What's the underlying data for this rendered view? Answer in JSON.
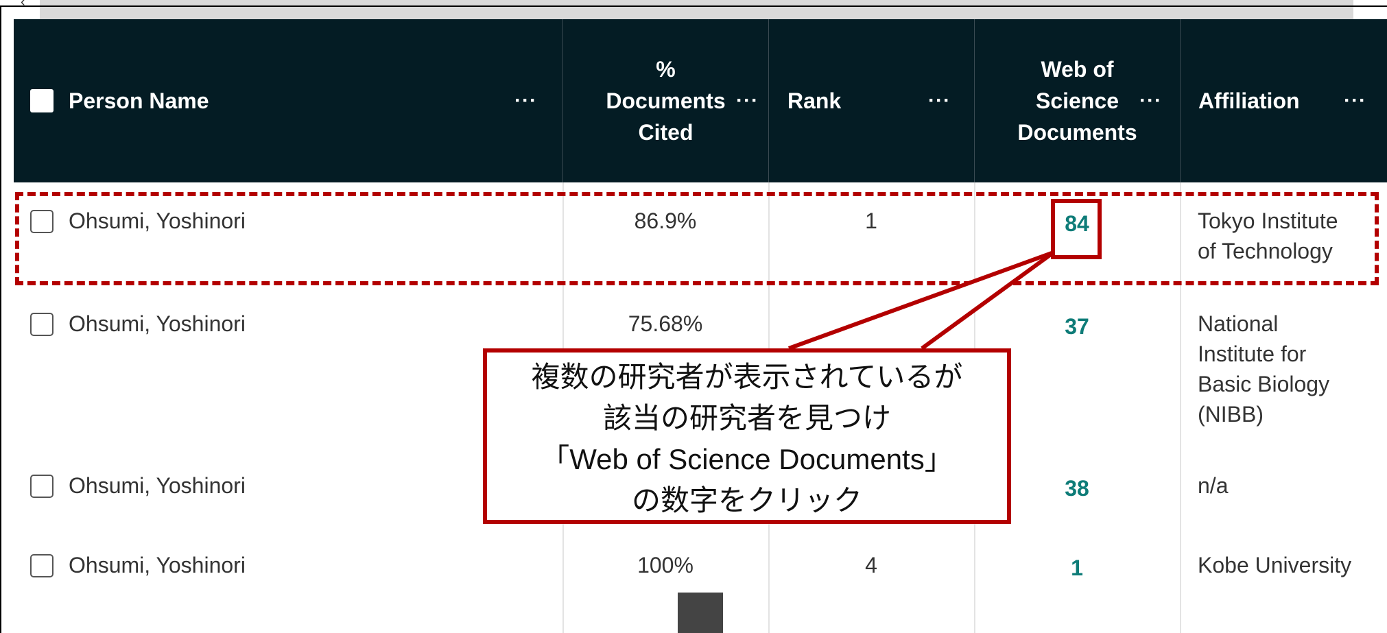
{
  "table": {
    "headers": {
      "person_name": "Person Name",
      "pct_docs_cited_l1": "%",
      "pct_docs_cited_l2": "Documents",
      "pct_docs_cited_l3": "Cited",
      "rank": "Rank",
      "wos_l1": "Web of",
      "wos_l2": "Science",
      "wos_l3": "Documents",
      "affiliation": "Affiliation",
      "menu": "···"
    },
    "rows": [
      {
        "name": "Ohsumi, Yoshinori",
        "pct_cited": "86.9%",
        "rank": "1",
        "wos_docs": "84",
        "affiliation": [
          "Tokyo Institute",
          "of Technology"
        ]
      },
      {
        "name": "Ohsumi, Yoshinori",
        "pct_cited": "75.68%",
        "rank": "",
        "wos_docs": "37",
        "affiliation": [
          "National",
          "Institute for",
          "Basic Biology",
          "(NIBB)"
        ]
      },
      {
        "name": "Ohsumi, Yoshinori",
        "pct_cited": "",
        "rank": "",
        "wos_docs": "38",
        "affiliation": [
          "n/a"
        ]
      },
      {
        "name": "Ohsumi, Yoshinori",
        "pct_cited": "100%",
        "rank": "4",
        "wos_docs": "1",
        "affiliation": [
          "Kobe University"
        ]
      }
    ]
  },
  "callout": {
    "lines": [
      "複数の研究者が表示されているが",
      "該当の研究者を見つけ",
      "「Web of Science Documents」",
      "の数字をクリック"
    ]
  },
  "colors": {
    "header_bg": "#041c24",
    "link_teal": "#0e7c78",
    "annotation_red": "#b30000"
  },
  "icons": {
    "scroll_left": "chevron-left-icon",
    "column_menu": "more-horizontal-icon"
  }
}
